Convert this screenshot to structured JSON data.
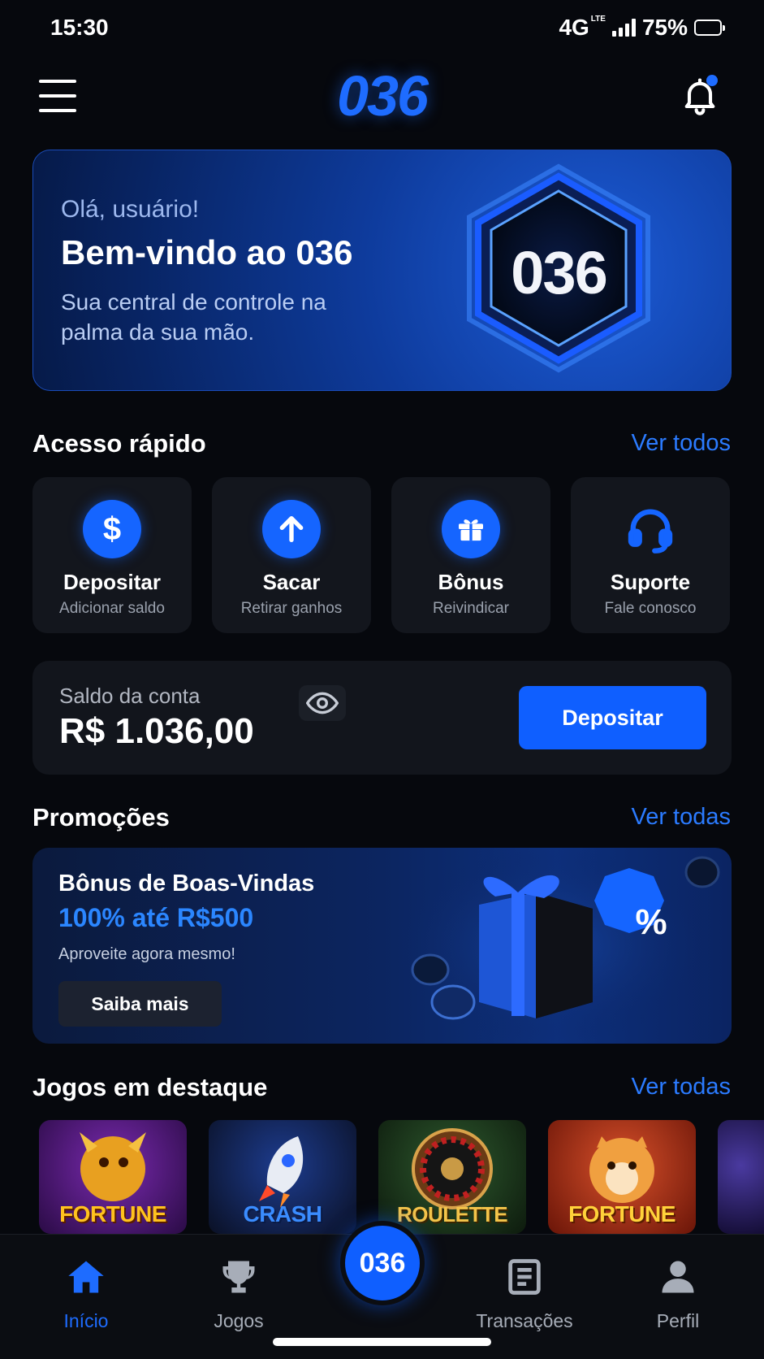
{
  "status_bar": {
    "time": "15:30",
    "network": "4G",
    "network_small": "LTE",
    "battery": "75%"
  },
  "header": {
    "logo": "036"
  },
  "hero": {
    "greeting": "Olá, usuário!",
    "title": "Bem-vindo ao 036",
    "subtitle": "Sua central de controle na palma da sua mão.",
    "badge": "036"
  },
  "quick_access": {
    "title": "Acesso rápido",
    "link": "Ver todos",
    "items": [
      {
        "label": "Depositar",
        "sub": "Adicionar saldo",
        "icon": "dollar-icon"
      },
      {
        "label": "Sacar",
        "sub": "Retirar ganhos",
        "icon": "arrow-up-icon"
      },
      {
        "label": "Bônus",
        "sub": "Reivindicar",
        "icon": "gift-icon"
      },
      {
        "label": "Suporte",
        "sub": "Fale conosco",
        "icon": "headset-icon"
      }
    ]
  },
  "balance": {
    "label": "Saldo da conta",
    "value": "R$ 1.036,00",
    "button": "Depositar"
  },
  "promotions": {
    "title": "Promoções",
    "link": "Ver todas",
    "card": {
      "title": "Bônus de Boas-Vindas",
      "highlight": "100% até R$500",
      "sub": "Aproveite agora mesmo!",
      "button": "Saiba mais",
      "badge": "%"
    }
  },
  "games": {
    "title": "Jogos em destaque",
    "link": "Ver todas",
    "items": [
      {
        "name": "FORTUNE"
      },
      {
        "name": "CRASH"
      },
      {
        "name": "ROULETTE"
      },
      {
        "name": "FORTUNE"
      }
    ]
  },
  "nav": {
    "items": [
      {
        "label": "Início",
        "icon": "home-icon"
      },
      {
        "label": "Jogos",
        "icon": "trophy-icon"
      },
      {
        "label": "Transações",
        "icon": "receipt-icon"
      },
      {
        "label": "Perfil",
        "icon": "user-icon"
      }
    ],
    "center": "036"
  },
  "colors": {
    "accent": "#1e6cff",
    "background": "#06080d",
    "card": "#13161d"
  }
}
